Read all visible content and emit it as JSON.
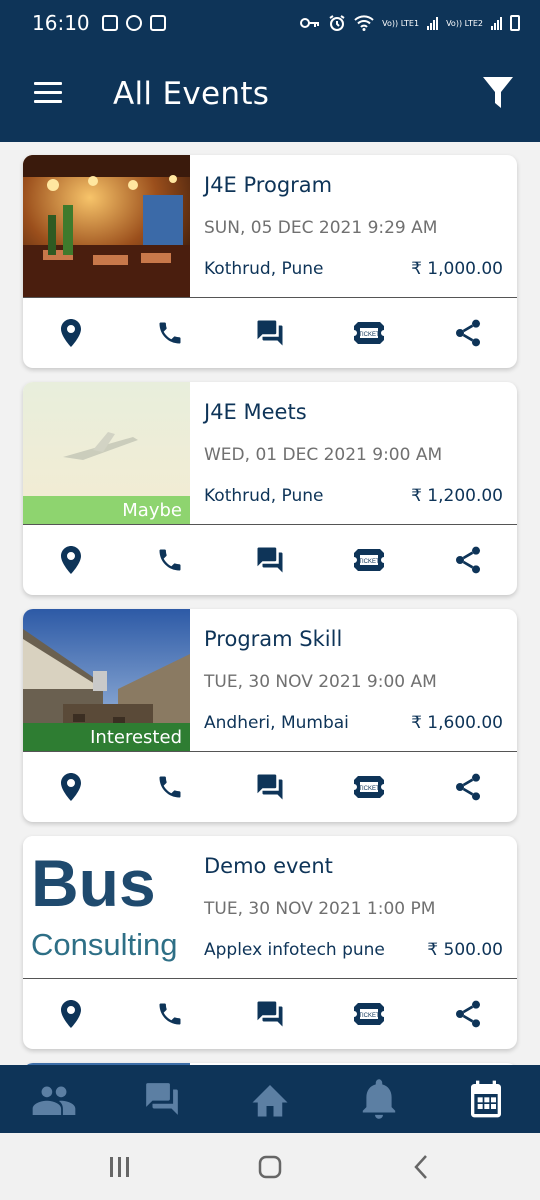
{
  "status_bar": {
    "time": "16:10",
    "net1": "Vo)) LTE1",
    "net2": "Vo)) LTE2"
  },
  "app_bar": {
    "title": "All Events",
    "menu_icon": "hamburger-menu-icon",
    "filter_icon": "filter-funnel-icon"
  },
  "events": [
    {
      "title": "J4E Program",
      "date": "SUN, 05 DEC 2021 9:29 AM",
      "location": "Kothrud, Pune",
      "price": "₹ 1,000.00",
      "rsvp": "",
      "image": "restaurant-night-photo"
    },
    {
      "title": "J4E Meets",
      "date": "WED, 01 DEC 2021 9:00 AM",
      "location": "Kothrud, Pune",
      "price": "₹ 1,200.00",
      "rsvp": "Maybe",
      "rsvp_color": "#8ed46f",
      "image": "airplane-sky-photo"
    },
    {
      "title": "Program Skill",
      "date": "TUE, 30 NOV 2021 9:00 AM",
      "location": "Andheri, Mumbai",
      "price": "₹ 1,600.00",
      "rsvp": "Interested",
      "rsvp_color": "#2e7d32",
      "image": "rooftop-terrace-photo"
    },
    {
      "title": "Demo event",
      "date": "TUE, 30 NOV 2021 1:00 PM",
      "location": "Applex infotech pune",
      "price": "₹ 500.00",
      "rsvp": "",
      "image": "business-consulting-logo",
      "image_text": [
        "Bus",
        "Consulting"
      ]
    }
  ],
  "card_actions": [
    "location-pin-icon",
    "phone-icon",
    "chat-icon",
    "ticket-icon",
    "share-icon"
  ],
  "ticket_text": "TICKET",
  "bottom_nav": [
    "people-icon",
    "forum-icon",
    "home-icon",
    "bell-icon",
    "calendar-icon"
  ],
  "colors": {
    "primary": "#0e3458",
    "maybe": "#8ed46f",
    "interested": "#2e7d32",
    "nav_inactive": "#5c7fa3"
  }
}
